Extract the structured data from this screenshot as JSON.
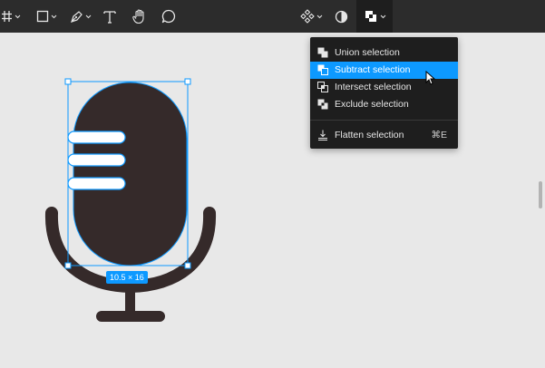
{
  "toolbar": {
    "tools": [
      {
        "name": "frame-tool",
        "icon": "hash-icon"
      },
      {
        "name": "shape-tool",
        "icon": "rectangle-icon"
      },
      {
        "name": "pen-tool",
        "icon": "pen-icon"
      },
      {
        "name": "text-tool",
        "icon": "text-icon"
      },
      {
        "name": "hand-tool",
        "icon": "hand-icon"
      },
      {
        "name": "comment-tool",
        "icon": "comment-icon"
      },
      {
        "name": "component-tool",
        "icon": "component-icon"
      },
      {
        "name": "mask-tool",
        "icon": "mask-icon"
      },
      {
        "name": "boolean-tool",
        "icon": "boolean-icon"
      }
    ]
  },
  "boolean_menu": {
    "items": [
      {
        "label": "Union selection",
        "icon": "union-icon",
        "highlighted": false
      },
      {
        "label": "Subtract selection",
        "icon": "subtract-icon",
        "highlighted": true
      },
      {
        "label": "Intersect selection",
        "icon": "intersect-icon",
        "highlighted": false
      },
      {
        "label": "Exclude selection",
        "icon": "exclude-icon",
        "highlighted": false
      }
    ],
    "flatten": {
      "label": "Flatten selection",
      "icon": "flatten-icon",
      "shortcut": "⌘E"
    }
  },
  "selection": {
    "size_label": "10.5 × 16"
  },
  "colors": {
    "toolbar_bg": "#2c2c2c",
    "canvas_bg": "#e8e8e8",
    "accent": "#0d99ff",
    "mic_fill": "#352a2a"
  }
}
